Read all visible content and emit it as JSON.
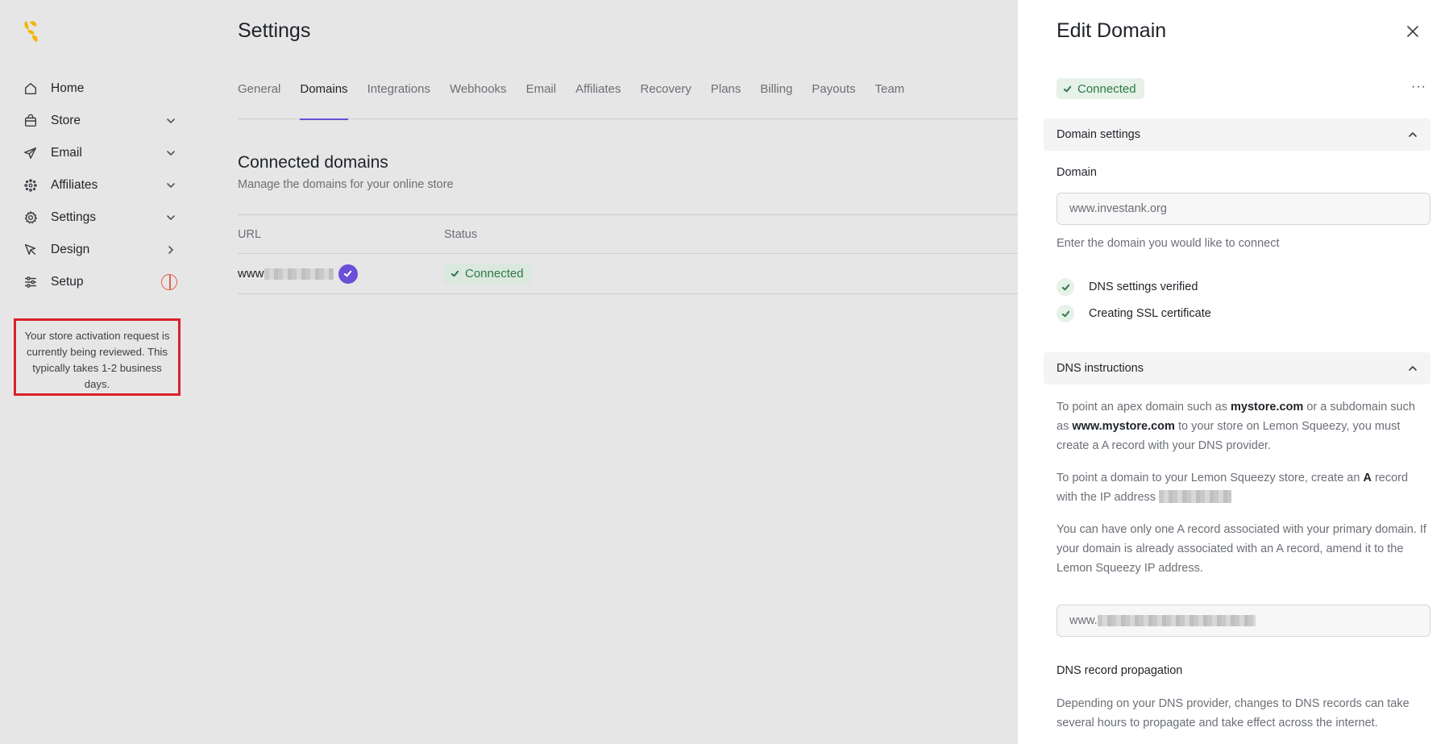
{
  "sidebar": {
    "items": [
      {
        "label": "Home",
        "icon": "home-icon"
      },
      {
        "label": "Store",
        "icon": "bag-icon"
      },
      {
        "label": "Email",
        "icon": "send-icon"
      },
      {
        "label": "Affiliates",
        "icon": "affiliates-icon"
      },
      {
        "label": "Settings",
        "icon": "gear-icon"
      },
      {
        "label": "Design",
        "icon": "cursor-icon"
      },
      {
        "label": "Setup",
        "icon": "sliders-icon"
      }
    ],
    "notice": "Your store activation request is currently being reviewed. This typically takes 1-2 business days."
  },
  "main": {
    "title": "Settings",
    "tabs": [
      "General",
      "Domains",
      "Integrations",
      "Webhooks",
      "Email",
      "Affiliates",
      "Recovery",
      "Plans",
      "Billing",
      "Payouts",
      "Team"
    ],
    "active_tab": "Domains",
    "section_title": "Connected domains",
    "section_subtitle": "Manage the domains for your online store",
    "table": {
      "headers": [
        "URL",
        "Status"
      ],
      "rows": [
        {
          "url_prefix": "www",
          "status": "Connected"
        }
      ]
    }
  },
  "panel": {
    "title": "Edit Domain",
    "status": "Connected",
    "more": "···",
    "domain_settings": {
      "header": "Domain settings",
      "label": "Domain",
      "value": "www.investank.org",
      "helper": "Enter the domain you would like to connect",
      "checks": [
        "DNS settings verified",
        "Creating SSL certificate"
      ]
    },
    "dns": {
      "header": "DNS instructions",
      "p1_a": "To point an apex domain such as ",
      "p1_b": "mystore.com",
      "p1_c": " or a subdomain such as ",
      "p1_d": "www.mystore.com",
      "p1_e": " to your store on Lemon Squeezy, you must create a A record with your DNS provider.",
      "p2_a": "To point a domain to your Lemon Squeezy store, create an ",
      "p2_b": "A",
      "p2_c": " record with the IP address",
      "p3": "You can have only one A record associated with your primary domain. If your domain is already associated with an A record, amend it to the Lemon Squeezy IP address.",
      "record_prefix": "www.",
      "propagation_title": "DNS record propagation",
      "propagation_text": "Depending on your DNS provider, changes to DNS records can take several hours to propagate and take effect across the internet."
    }
  }
}
